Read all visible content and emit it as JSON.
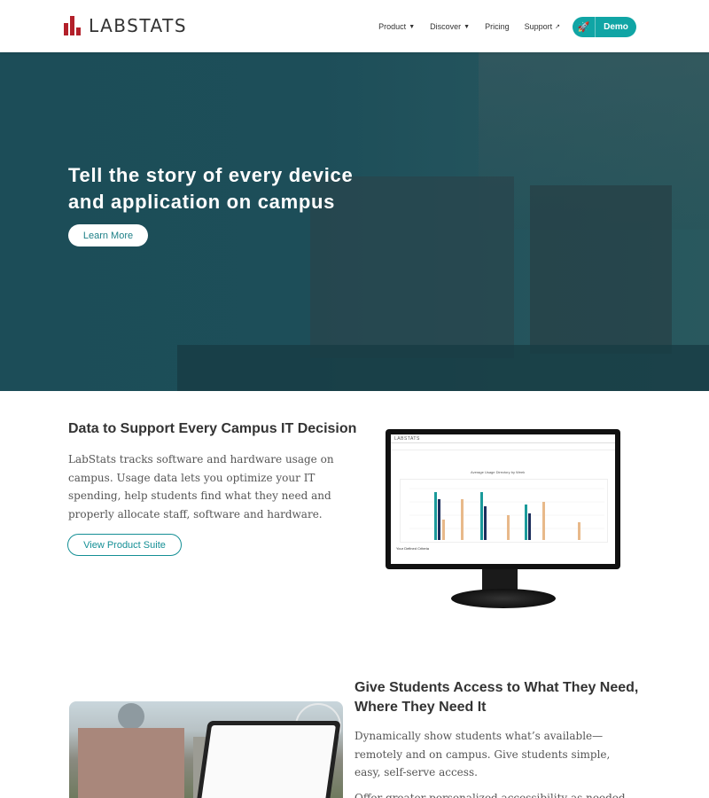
{
  "header": {
    "logo_text": "LABSTATS",
    "nav": [
      {
        "label": "Product",
        "caret": true
      },
      {
        "label": "Discover",
        "caret": true
      },
      {
        "label": "Pricing",
        "caret": false
      },
      {
        "label": "Support",
        "external": true
      }
    ],
    "demo_label": "Demo",
    "colors": {
      "brand_red": "#b3202a",
      "accent_teal": "#10a5a5"
    }
  },
  "hero": {
    "title_line1": "Tell the story of every device",
    "title_line2": "and application on campus",
    "cta_label": "Learn More"
  },
  "section1": {
    "title": "Data to Support Every Campus IT Decision",
    "body": "LabStats tracks software and hardware usage on campus. Usage data lets you optimize your IT spending, help students find what they need and properly allocate staff, software and hardware.",
    "cta_label": "View Product Suite",
    "monitor": {
      "logo": "LABSTATS",
      "chart_title": "Average Usage Directory by Week",
      "footer": "Your Defined Criteria"
    }
  },
  "section2": {
    "title": "Give Students Access to What They Need, Where They Need It",
    "body": "Dynamically show students what’s available—remotely and on campus. Give students simple, easy, self-serve access.",
    "body2": "Offer greater personalized accessibility as needed"
  }
}
